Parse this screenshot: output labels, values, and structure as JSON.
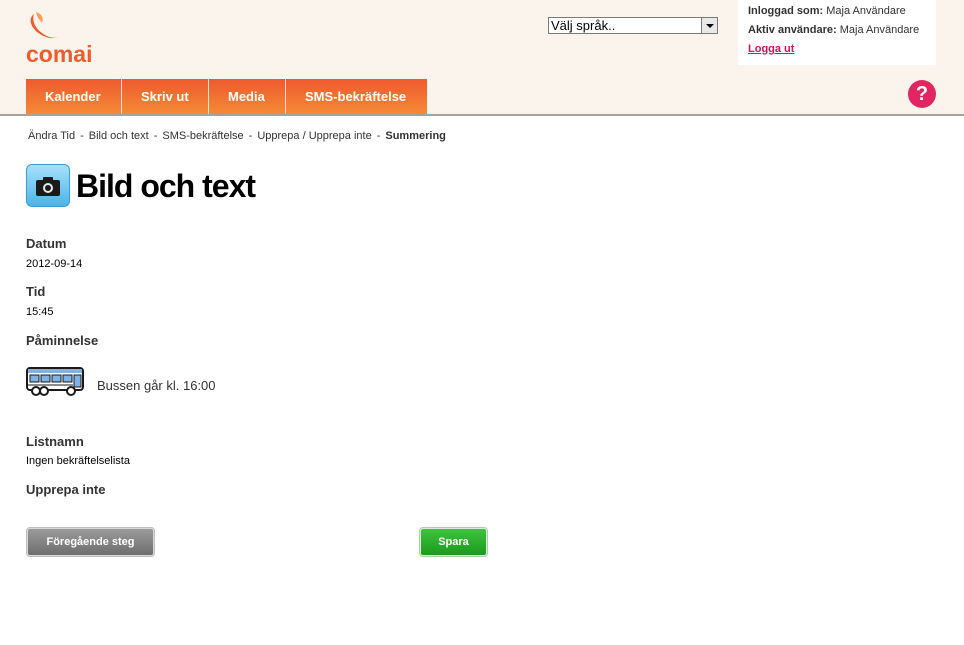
{
  "app": {
    "logo_text": "comai",
    "language_select": {
      "selected": "Välj språk.."
    },
    "user": {
      "logged_in_label": "Inloggad som:",
      "logged_in_name": "Maja Användare",
      "active_label": "Aktiv användare:",
      "active_name": "Maja Användare",
      "logout": "Logga ut"
    },
    "help_symbol": "?"
  },
  "nav": {
    "tabs": [
      {
        "label": "Kalender"
      },
      {
        "label": "Skriv ut"
      },
      {
        "label": "Media"
      },
      {
        "label": "SMS-bekräftelse"
      }
    ]
  },
  "breadcrumb": {
    "items": [
      "Ändra Tid",
      "Bild och text",
      "SMS-bekräftelse",
      "Upprepa / Upprepa inte",
      "Summering"
    ],
    "separator": "-"
  },
  "page": {
    "title": "Bild och text",
    "title_icon": "camera-icon"
  },
  "summary": {
    "date_label": "Datum",
    "date_value": "2012-09-14",
    "time_label": "Tid",
    "time_value": "15:45",
    "reminder_label": "Påminnelse",
    "reminder_icon": "bus-icon",
    "reminder_text": "Bussen går kl. 16:00",
    "list_label": "Listnamn",
    "list_value": "Ingen bekräftelselista",
    "repeat_label": "Upprepa inte"
  },
  "buttons": {
    "previous": "Föregående steg",
    "save": "Spara"
  },
  "colors": {
    "brand_orange": "#ef5c2c",
    "logout_pink": "#d4145a",
    "help_pink": "#e42563",
    "save_green": "#1c9a1c"
  }
}
